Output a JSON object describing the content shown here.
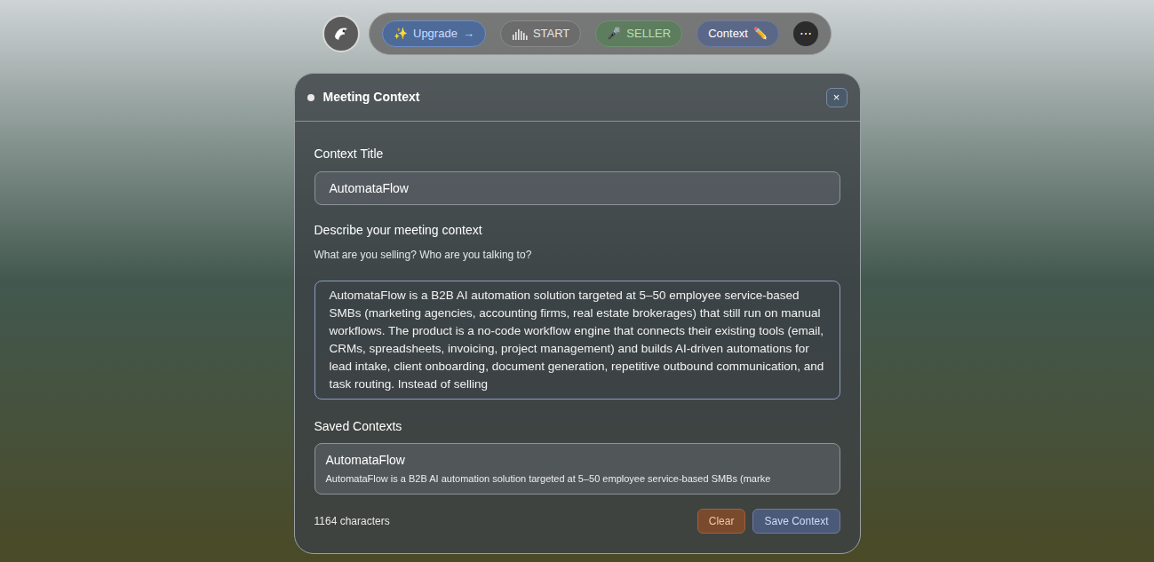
{
  "toolbar": {
    "items": [
      {
        "label": "Upgrade",
        "prefix": "✨",
        "suffix": "→",
        "kind": "upgrade"
      },
      {
        "label": "START",
        "prefix": "",
        "suffix": "",
        "kind": "start"
      },
      {
        "label": "SELLER",
        "prefix": "🎤",
        "suffix": "",
        "kind": "seller"
      },
      {
        "label": "Context",
        "prefix": "",
        "suffix": "✏️",
        "kind": "context"
      }
    ],
    "more": "⋯"
  },
  "dialog": {
    "title": "Meeting Context",
    "close": "×",
    "title_field": {
      "label": "Context Title",
      "value": "AutomataFlow"
    },
    "description_field": {
      "label": "Describe your meeting context",
      "hint": "What are you selling? Who are you talking to?",
      "value": "AutomataFlow is a B2B AI automation solution targeted at 5–50 employee service-based SMBs (marketing agencies, accounting firms, real estate brokerages) that still run on manual workflows. The product is a no-code workflow engine that connects their existing tools (email, CRMs, spreadsheets, invoicing, project management) and builds AI-driven automations for lead intake, client onboarding, document generation, repetitive outbound communication, and task routing. Instead of selling"
    },
    "saved": {
      "label": "Saved Contexts",
      "items": [
        {
          "title": "AutomataFlow",
          "description": "AutomataFlow is a B2B AI automation solution targeted at 5–50 employee service-based SMBs (marke"
        }
      ]
    },
    "footer": {
      "count": "1164 characters",
      "buttons": [
        "Clear",
        "Save Context"
      ]
    }
  }
}
